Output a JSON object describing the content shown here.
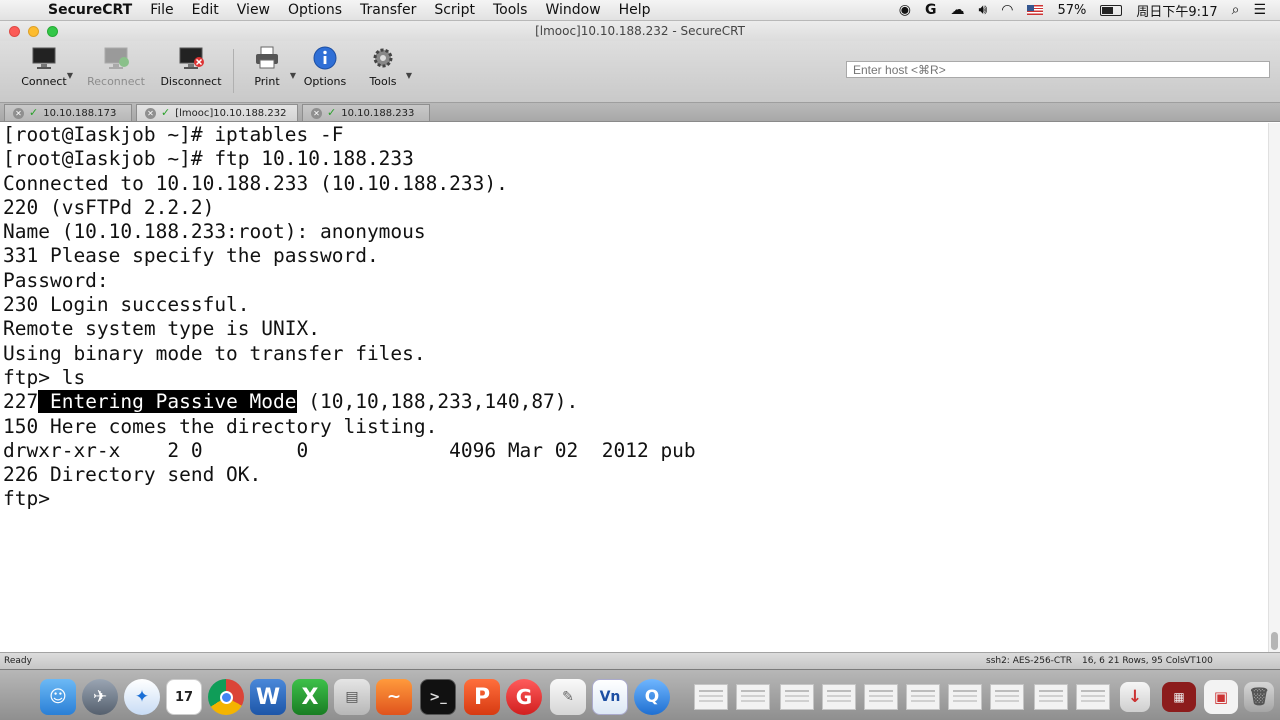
{
  "menubar": {
    "app_name": "SecureCRT",
    "items": [
      "File",
      "Edit",
      "View",
      "Options",
      "Transfer",
      "Script",
      "Tools",
      "Window",
      "Help"
    ],
    "battery": "57%",
    "clock": "周日下午9:17"
  },
  "window": {
    "title": "[lmooc]10.10.188.232 - SecureCRT"
  },
  "toolbar": {
    "connect": "Connect",
    "reconnect": "Reconnect",
    "disconnect": "Disconnect",
    "print": "Print",
    "options": "Options",
    "tools": "Tools",
    "host_placeholder": "Enter host <⌘R>"
  },
  "tabs": [
    {
      "label": "10.10.188.173"
    },
    {
      "label": "[lmooc]10.10.188.232"
    },
    {
      "label": "10.10.188.233"
    }
  ],
  "terminal": {
    "lines": [
      "[root@Iaskjob ~]# iptables -F",
      "[root@Iaskjob ~]# ftp 10.10.188.233",
      "Connected to 10.10.188.233 (10.10.188.233).",
      "220 (vsFTPd 2.2.2)",
      "Name (10.10.188.233:root): anonymous",
      "331 Please specify the password.",
      "Password:",
      "230 Login successful.",
      "Remote system type is UNIX.",
      "Using binary mode to transfer files.",
      "ftp> ls"
    ],
    "passive_prefix": "227",
    "passive_highlight": " Entering Passive Mode",
    "passive_suffix": " (10,10,188,233,140,87).",
    "lines_after": [
      "150 Here comes the directory listing.",
      "drwxr-xr-x    2 0        0            4096 Mar 02  2012 pub",
      "226 Directory send OK.",
      "ftp>"
    ]
  },
  "statusbar": {
    "ready": "Ready",
    "cipher": "ssh2: AES-256-CTR",
    "cursor": "16, 6",
    "size": "21 Rows, 95 Cols",
    "emulation": "VT100"
  },
  "dock": {
    "calendar_day": "17",
    "word": "W",
    "excel": "X"
  },
  "colors": {
    "selection_bg": "#000000",
    "tab_check": "#2aa12a",
    "close_red": "#fc5b57"
  }
}
